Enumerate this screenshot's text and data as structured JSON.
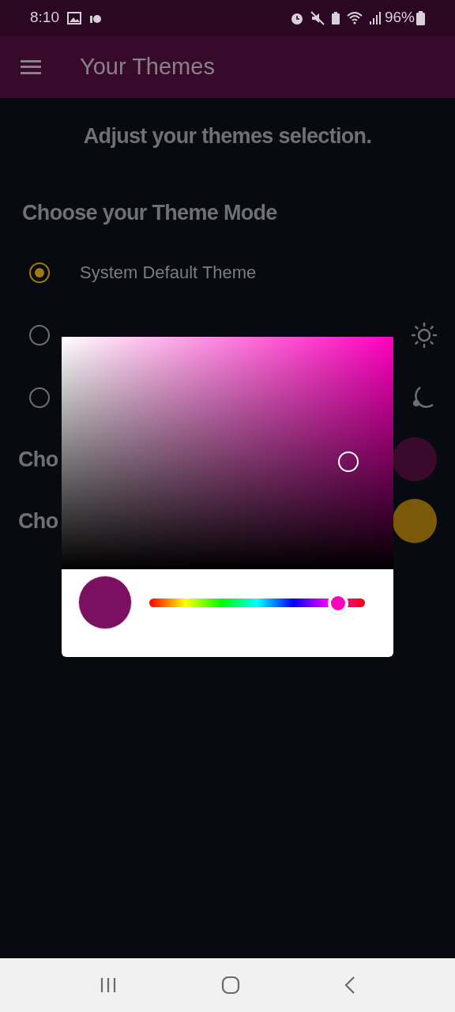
{
  "status_bar": {
    "time": "8:10",
    "battery": "96%"
  },
  "app_bar": {
    "title": "Your Themes"
  },
  "intro": "Adjust your themes selection.",
  "theme_mode": {
    "heading": "Choose your Theme Mode",
    "options": [
      {
        "label": "System Default Theme",
        "selected": true,
        "kind": "none"
      },
      {
        "selected": false,
        "kind": "sun"
      },
      {
        "selected": false,
        "kind": "moon"
      }
    ]
  },
  "color_rows": [
    {
      "label": "Cho",
      "color": "#3a0a2c"
    },
    {
      "label": "Cho",
      "color": "#7a5a0a"
    }
  ],
  "color_picker": {
    "hue": {
      "level": 0.875
    }
  }
}
